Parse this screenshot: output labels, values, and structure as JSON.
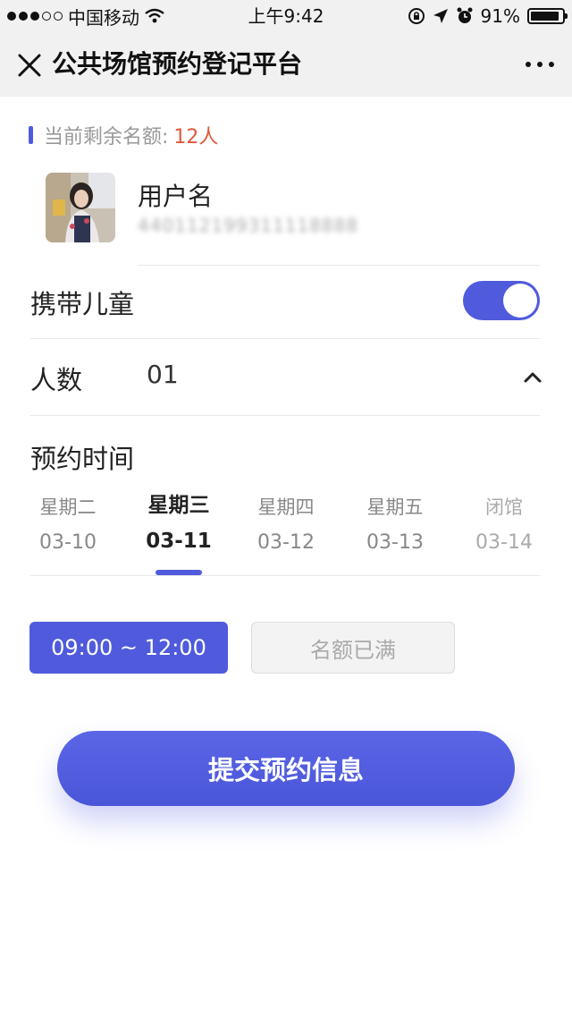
{
  "status_bar": {
    "carrier": "中国移动",
    "time": "上午9:42",
    "battery": "91%",
    "battery_level": 0.91
  },
  "nav": {
    "title": "公共场馆预约登记平台",
    "close_icon": "close-icon",
    "more_icon": "more-icon"
  },
  "quota": {
    "label": "当前剩余名额:",
    "count": "12人"
  },
  "user": {
    "name": "用户名",
    "id_number": "440112199311118888"
  },
  "children": {
    "label": "携带儿童",
    "enabled": true
  },
  "people": {
    "label": "人数",
    "value": "01"
  },
  "schedule": {
    "label": "预约时间",
    "days": [
      {
        "weekday": "星期二",
        "date": "03-10"
      },
      {
        "weekday": "星期三",
        "date": "03-11"
      },
      {
        "weekday": "星期四",
        "date": "03-12"
      },
      {
        "weekday": "星期五",
        "date": "03-13"
      },
      {
        "weekday": "闭馆",
        "date": "03-14"
      }
    ],
    "selected_index": 1
  },
  "slots": [
    {
      "label": "09:00 ~ 12:00",
      "state": "selected"
    },
    {
      "label": "名额已满",
      "state": "full"
    }
  ],
  "submit_label": "提交预约信息",
  "colors": {
    "accent": "#4f5bdc",
    "quota_highlight": "#e0583a"
  }
}
